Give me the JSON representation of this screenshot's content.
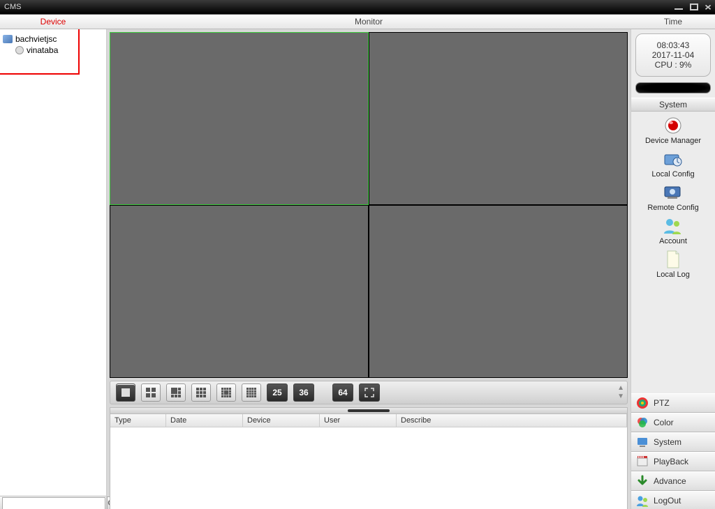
{
  "window": {
    "title": "CMS"
  },
  "header": {
    "device": "Device",
    "monitor": "Monitor",
    "time": "Time"
  },
  "devices": {
    "root": "bachvietjsc",
    "child": "vinataba"
  },
  "clock": {
    "time": "08:03:43",
    "date": "2017-11-04",
    "cpu": "CPU : 9%"
  },
  "system": {
    "header": "System",
    "items": {
      "device_manager": "Device Manager",
      "local_config": "Local Config",
      "remote_config": "Remote Config",
      "account": "Account",
      "local_log": "Local Log"
    }
  },
  "tabs": {
    "ptz": "PTZ",
    "color": "Color",
    "system": "System",
    "playback": "PlayBack",
    "advance": "Advance",
    "logout": "LogOut"
  },
  "layout_numbers": {
    "n25": "25",
    "n36": "36",
    "n64": "64"
  },
  "log_columns": {
    "type": "Type",
    "date": "Date",
    "device": "Device",
    "user": "User",
    "describe": "Describe"
  }
}
